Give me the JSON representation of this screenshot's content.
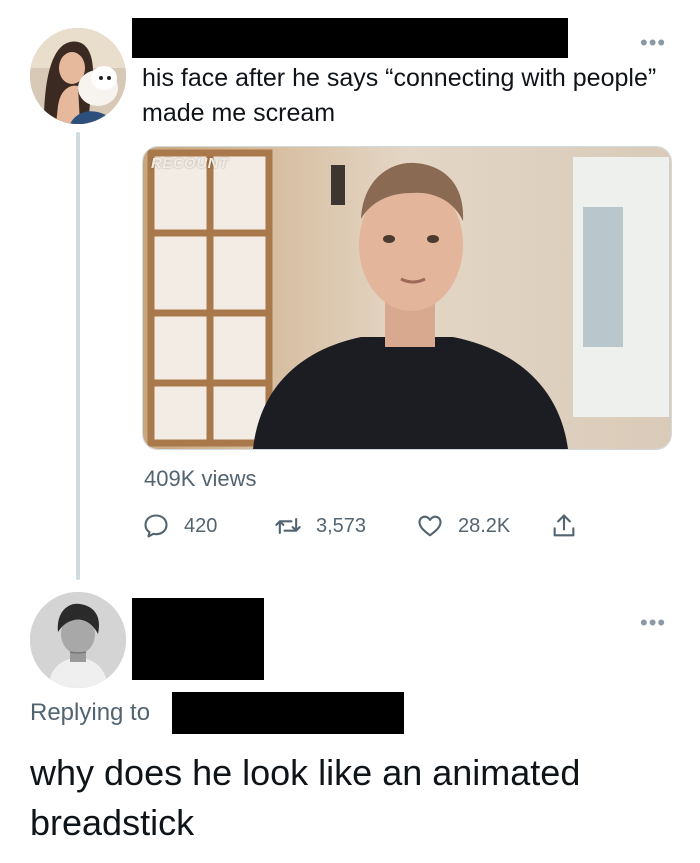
{
  "tweet": {
    "text": "his face after he says “connecting with people” made me scream",
    "media_label": "RECOUNT",
    "views": "409K views",
    "replies": "420",
    "retweets": "3,573",
    "likes": "28.2K",
    "more_icon": "•••"
  },
  "reply": {
    "replying_to_label": "Replying to",
    "text": "why does he look like an animated breadstick",
    "more_icon": "•••"
  },
  "icons": {
    "reply": "reply-icon",
    "retweet": "retweet-icon",
    "like": "heart-icon",
    "share": "share-icon"
  },
  "colors": {
    "text_primary": "#0f1419",
    "text_secondary": "#536471",
    "thread_line": "#cfd9de"
  }
}
